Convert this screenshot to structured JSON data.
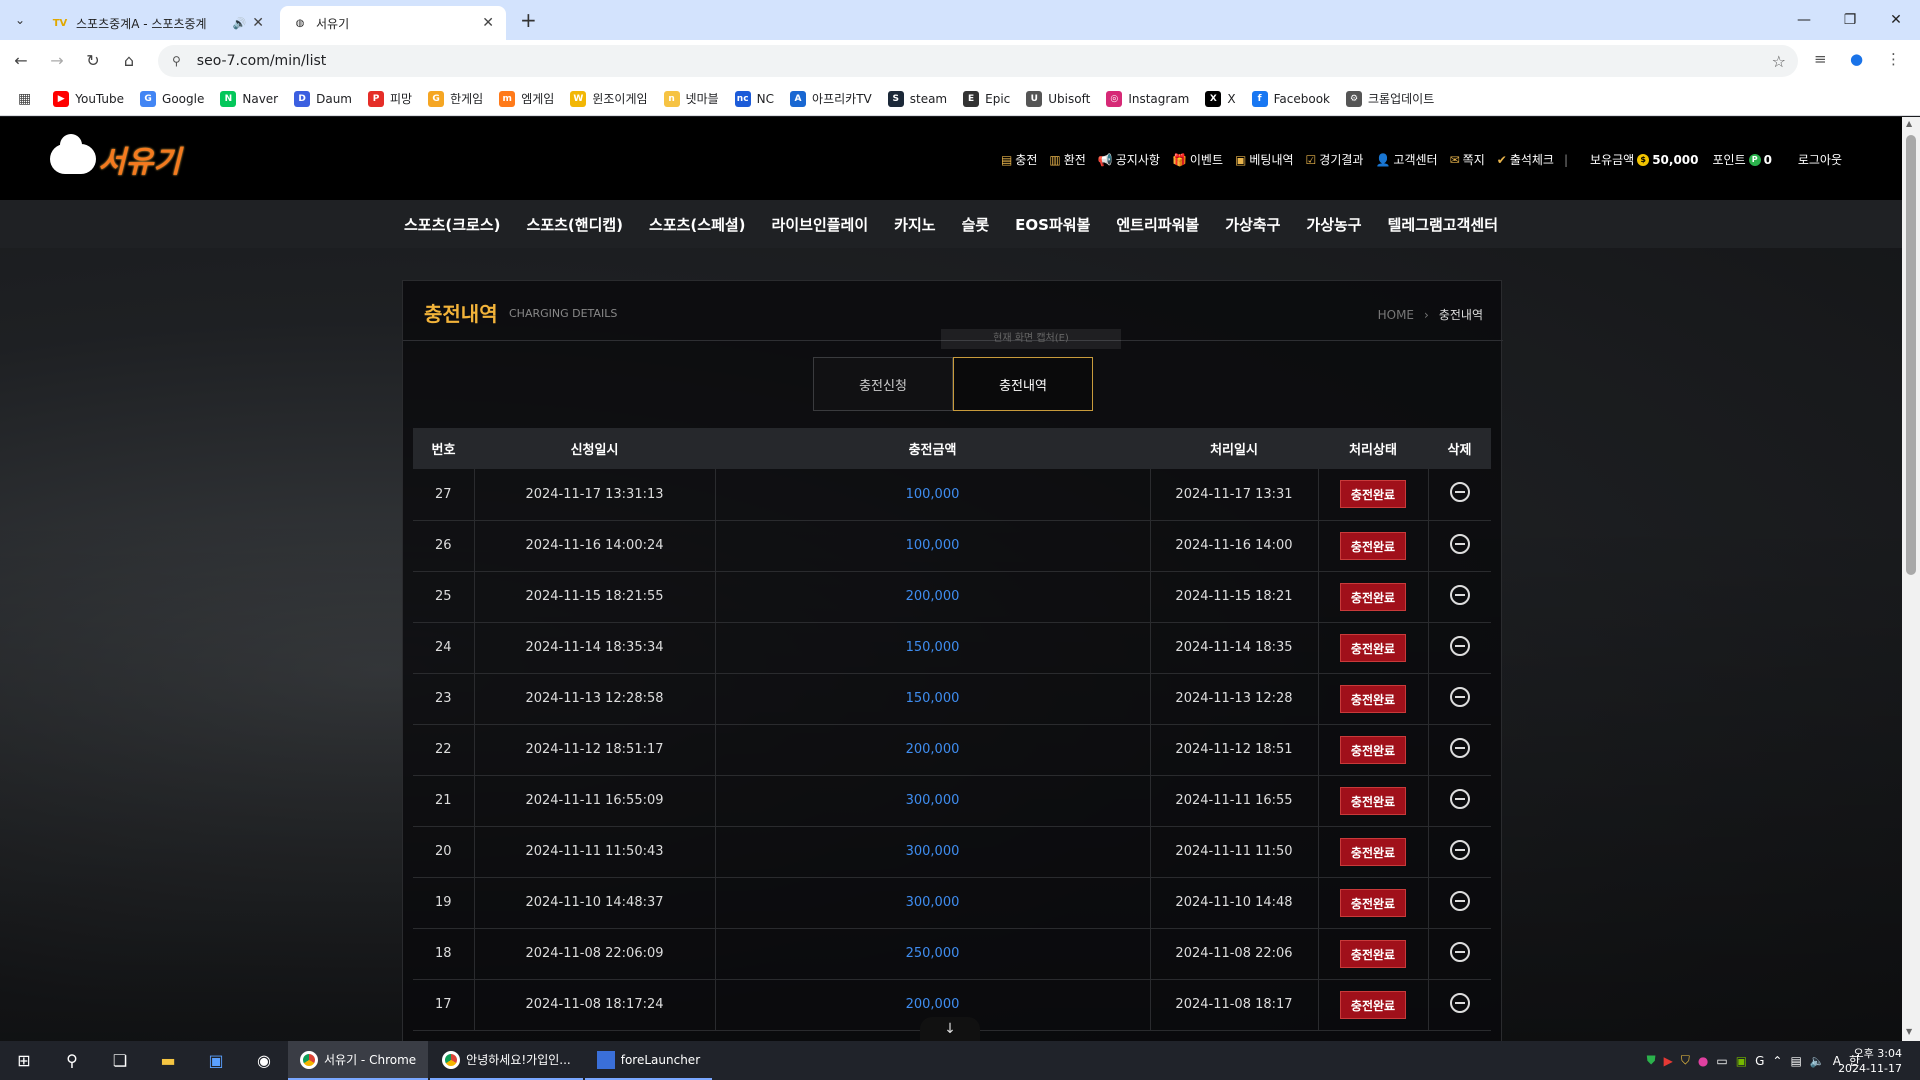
{
  "browser": {
    "tabs": [
      {
        "favicon": "TV",
        "title": "스포츠중계A - 스포츠중계"
      },
      {
        "favicon": "globe",
        "title": "서유기"
      }
    ],
    "url": "seo-7.com/min/list",
    "bookmarks": [
      {
        "label": "YouTube",
        "color": "#ff0000",
        "glyph": "▶"
      },
      {
        "label": "Google",
        "color": "#4285f4",
        "glyph": "G"
      },
      {
        "label": "Naver",
        "color": "#03c75a",
        "glyph": "N"
      },
      {
        "label": "Daum",
        "color": "#3b5fe0",
        "glyph": "D"
      },
      {
        "label": "피망",
        "color": "#e52d27",
        "glyph": "P"
      },
      {
        "label": "한게임",
        "color": "#f5a623",
        "glyph": "G"
      },
      {
        "label": "엠게임",
        "color": "#ff7a1a",
        "glyph": "m"
      },
      {
        "label": "윈조이게임",
        "color": "#f2b705",
        "glyph": "W"
      },
      {
        "label": "넷마블",
        "color": "#f6c343",
        "glyph": "n"
      },
      {
        "label": "NC",
        "color": "#1c5bd8",
        "glyph": "nc"
      },
      {
        "label": "아프리카TV",
        "color": "#1967d2",
        "glyph": "A"
      },
      {
        "label": "steam",
        "color": "#1b2838",
        "glyph": "S"
      },
      {
        "label": "Epic",
        "color": "#333333",
        "glyph": "E"
      },
      {
        "label": "Ubisoft",
        "color": "#555555",
        "glyph": "U"
      },
      {
        "label": "Instagram",
        "color": "#d62976",
        "glyph": "◎"
      },
      {
        "label": "X",
        "color": "#000000",
        "glyph": "X"
      },
      {
        "label": "Facebook",
        "color": "#1877f2",
        "glyph": "f"
      },
      {
        "label": "크롬업데이트",
        "color": "#555555",
        "glyph": "⚙"
      }
    ]
  },
  "site": {
    "logo_text": "서유기",
    "top_menu": [
      {
        "label": "충전",
        "icon": "wallet-icon",
        "glyph": "▤"
      },
      {
        "label": "환전",
        "icon": "exchange-icon",
        "glyph": "▥"
      },
      {
        "label": "공지사항",
        "icon": "megaphone-icon",
        "glyph": "📢"
      },
      {
        "label": "이벤트",
        "icon": "gift-icon",
        "glyph": "🎁"
      },
      {
        "label": "베팅내역",
        "icon": "clipboard-icon",
        "glyph": "▣"
      },
      {
        "label": "경기결과",
        "icon": "checklist-icon",
        "glyph": "☑"
      },
      {
        "label": "고객센터",
        "icon": "support-icon",
        "glyph": "👤"
      },
      {
        "label": "쪽지",
        "icon": "message-icon",
        "glyph": "✉"
      },
      {
        "label": "출석체크",
        "icon": "attendance-icon",
        "glyph": "✔"
      }
    ],
    "balance_label": "보유금액",
    "balance_value": "50,000",
    "point_label": "포인트",
    "point_value": "0",
    "logout_label": "로그아웃",
    "gnb": [
      "스포츠(크로스)",
      "스포츠(핸디캡)",
      "스포츠(스페셜)",
      "라이브인플레이",
      "카지노",
      "슬롯",
      "EOS파워볼",
      "엔트리파워볼",
      "가상축구",
      "가상농구",
      "텔레그램고객센터"
    ]
  },
  "panel": {
    "title": "충전내역",
    "subtitle": "CHARGING DETAILS",
    "breadcrumb_home": "HOME",
    "breadcrumb_current": "충전내역",
    "ghost_text": "현재 화면 캡처(E)",
    "tabs": [
      "충전신청",
      "충전내역"
    ]
  },
  "table": {
    "headers": [
      "번호",
      "신청일시",
      "충전금액",
      "처리일시",
      "처리상태",
      "삭제"
    ],
    "status_label": "충전완료",
    "rows": [
      [
        "27",
        "2024-11-17 13:31:13",
        "100,000",
        "2024-11-17 13:31"
      ],
      [
        "26",
        "2024-11-16 14:00:24",
        "100,000",
        "2024-11-16 14:00"
      ],
      [
        "25",
        "2024-11-15 18:21:55",
        "200,000",
        "2024-11-15 18:21"
      ],
      [
        "24",
        "2024-11-14 18:35:34",
        "150,000",
        "2024-11-14 18:35"
      ],
      [
        "23",
        "2024-11-13 12:28:58",
        "150,000",
        "2024-11-13 12:28"
      ],
      [
        "22",
        "2024-11-12 18:51:17",
        "200,000",
        "2024-11-12 18:51"
      ],
      [
        "21",
        "2024-11-11 16:55:09",
        "300,000",
        "2024-11-11 16:55"
      ],
      [
        "20",
        "2024-11-11 11:50:43",
        "300,000",
        "2024-11-11 11:50"
      ],
      [
        "19",
        "2024-11-10 14:48:37",
        "300,000",
        "2024-11-10 14:48"
      ],
      [
        "18",
        "2024-11-08 22:06:09",
        "250,000",
        "2024-11-08 22:06"
      ],
      [
        "17",
        "2024-11-08 18:17:24",
        "200,000",
        "2024-11-08 18:17"
      ]
    ]
  },
  "taskbar": {
    "apps": [
      {
        "label": "서유기 - Chrome",
        "active": true
      },
      {
        "label": "안녕하세요!가입인...",
        "active": false
      },
      {
        "label": "foreLauncher",
        "active": false
      }
    ],
    "time": "오후 3:04",
    "date": "2024-11-17"
  },
  "colors": {
    "accent_gold": "#f2b33a",
    "amount_blue": "#3f8df0",
    "status_red": "#a0101a"
  }
}
